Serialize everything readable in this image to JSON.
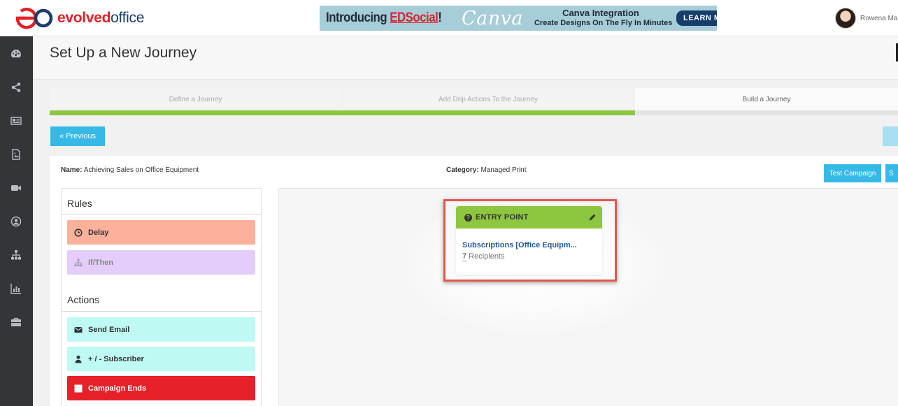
{
  "brand": {
    "name_part1": "evolved",
    "name_part2": "office",
    "colors": {
      "red": "#e32125",
      "navy": "#1c3d6e"
    }
  },
  "banner": {
    "intro": "Introducing ",
    "product": "EDSocial",
    "exclaim": "!",
    "canva": "Canva",
    "headline": "Canva Integration",
    "subline": "Create Designs On The Fly In Minutes",
    "cta": "LEARN MORE"
  },
  "user": {
    "name": "Rowena Ma"
  },
  "sidebar": {
    "icons": [
      "dashboard-icon",
      "share-icon",
      "newspaper-icon",
      "image-file-icon",
      "video-camera-icon",
      "user-circle-icon",
      "sitemap-icon",
      "bar-chart-icon",
      "briefcase-icon"
    ]
  },
  "page": {
    "title": "Set Up a New Journey",
    "steps": [
      {
        "label": "Define a Journey",
        "state": "complete"
      },
      {
        "label": "Add Drip Actions To the Journey",
        "state": "complete"
      },
      {
        "label": "Build a Journey",
        "state": "current"
      }
    ],
    "step_colors": {
      "complete": "#8dc63f",
      "pending": "#e3e3e3"
    },
    "previous_label": "« Previous"
  },
  "journey": {
    "name_label": "Name:",
    "name_value": " Achieving Sales on Office Equipment",
    "category_label": "Category:",
    "category_value": " Managed Print",
    "test_button": "Test Campaign",
    "second_button": "S"
  },
  "palette": {
    "rules_heading": "Rules",
    "actions_heading": "Actions",
    "rules": [
      {
        "label": "Delay",
        "icon": "clock-icon",
        "color": "#fdb09a"
      },
      {
        "label": "If/Then",
        "icon": "sitemap-icon",
        "color": "#e4ccfb"
      }
    ],
    "actions": [
      {
        "label": "Send Email",
        "icon": "envelope-icon",
        "color": "#bef9f4"
      },
      {
        "label": "+ / - Subscriber",
        "icon": "user-icon",
        "color": "#bef9f4"
      },
      {
        "label": "Campaign Ends",
        "icon": "stop-square-icon",
        "color": "#e62129"
      }
    ]
  },
  "entry_node": {
    "title": "ENTRY POINT",
    "list_name": "Subscriptions [Office Equipm...",
    "recipient_count": "7",
    "recipients_label": " Recipients"
  }
}
